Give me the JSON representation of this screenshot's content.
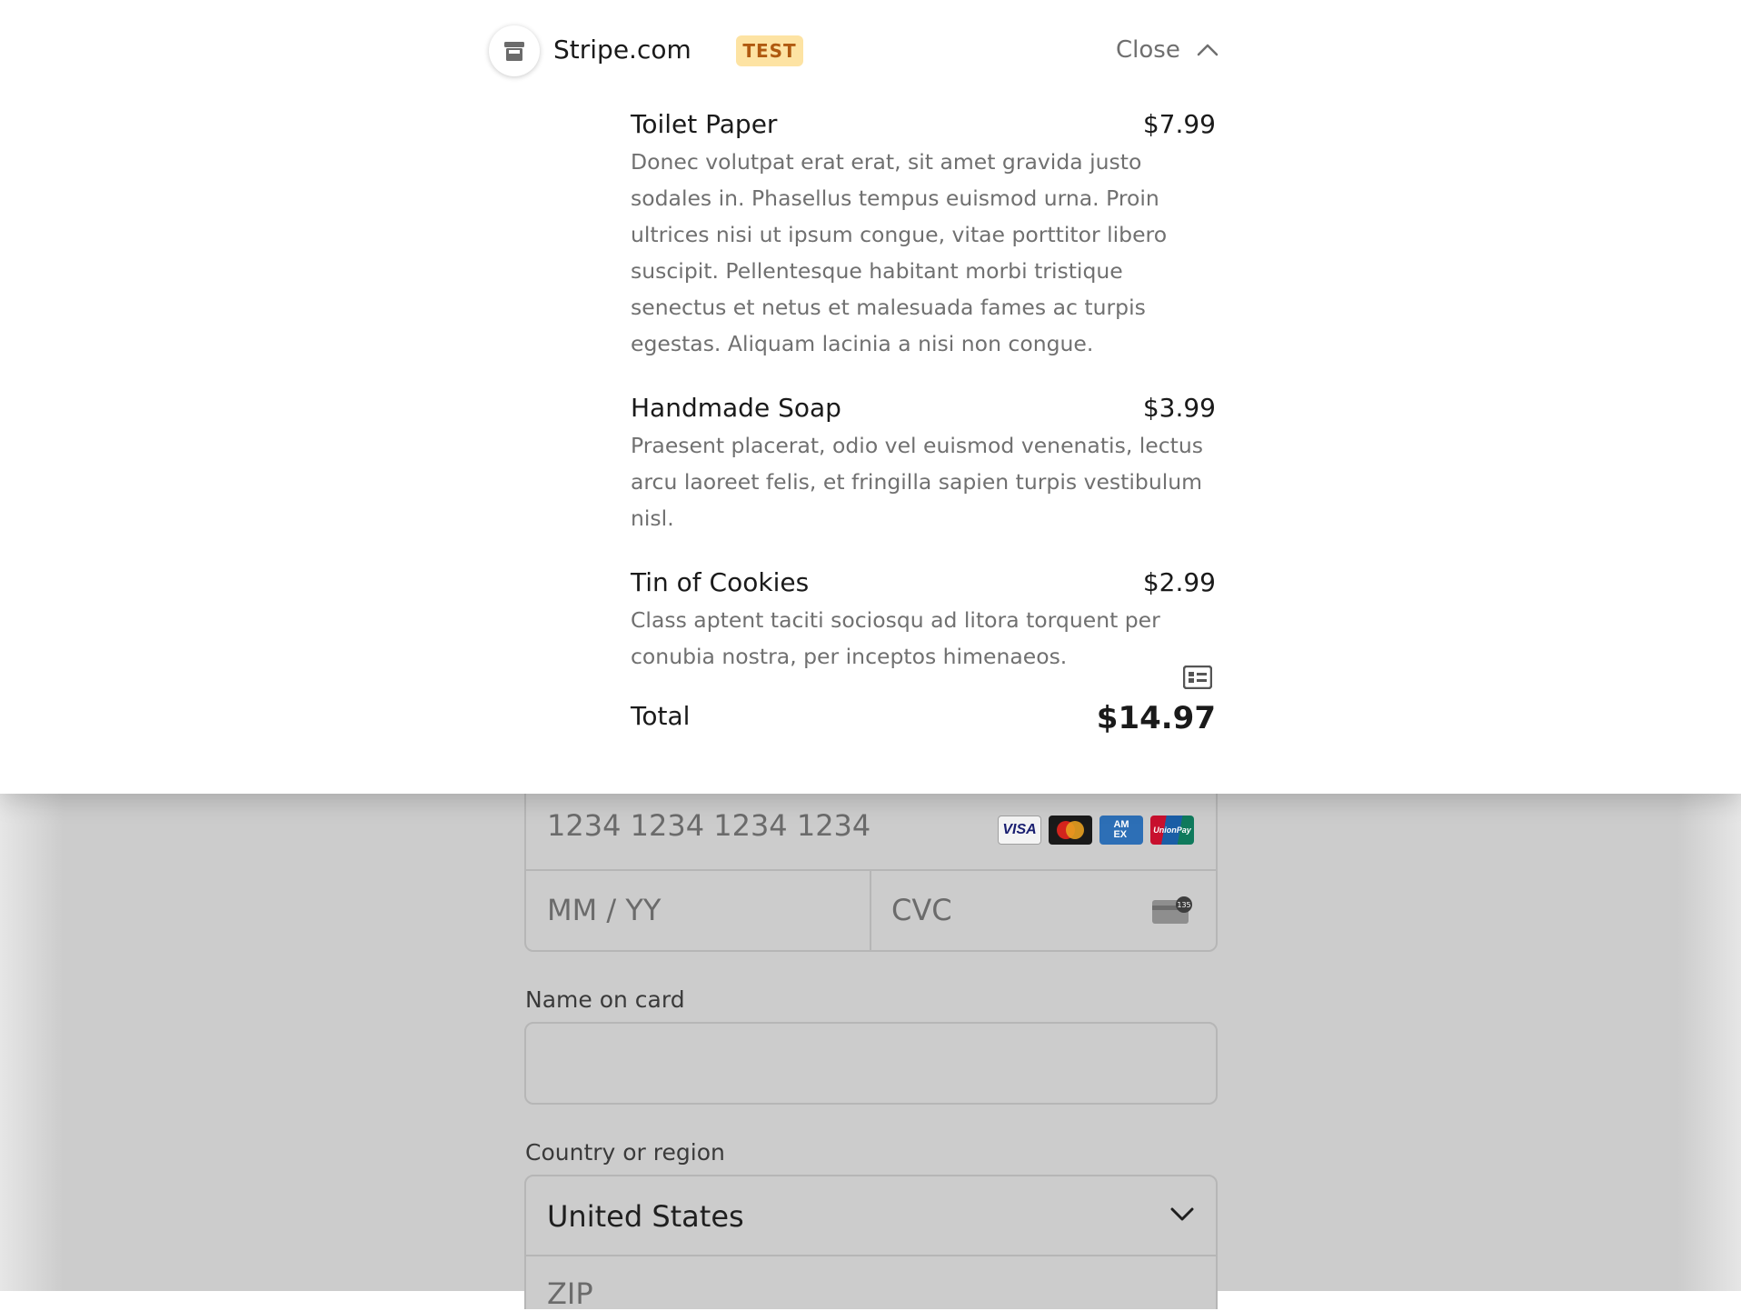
{
  "header": {
    "merchant_name": "Stripe.com",
    "test_badge": "TEST",
    "close_label": "Close"
  },
  "items": [
    {
      "name": "Toilet Paper",
      "price": "$7.99",
      "description": "Donec volutpat erat erat, sit amet gravida justo sodales in. Phasellus tempus euismod urna. Proin ultrices nisi ut ipsum congue, vitae porttitor libero suscipit. Pellentesque habitant morbi tristique senectus et netus et malesuada fames ac turpis egestas. Aliquam lacinia a nisi non congue."
    },
    {
      "name": "Handmade Soap",
      "price": "$3.99",
      "description": "Praesent placerat, odio vel euismod venenatis, lectus arcu laoreet felis, et fringilla sapien turpis vestibulum nisl."
    },
    {
      "name": "Tin of Cookies",
      "price": "$2.99",
      "description": "Class aptent taciti sociosqu ad litora torquent per conubia nostra, per inceptos himenaeos."
    }
  ],
  "total": {
    "label": "Total",
    "amount": "$14.97"
  },
  "payment_form": {
    "card_number_placeholder": "1234 1234 1234 1234",
    "expiry_placeholder": "MM / YY",
    "cvc_placeholder": "CVC",
    "card_brands": [
      "VISA",
      "Mastercard",
      "AMEX",
      "UnionPay"
    ],
    "cvc_hint": "135",
    "name_label": "Name on card",
    "name_value": "",
    "country_label": "Country or region",
    "country_value": "United States",
    "zip_placeholder": "ZIP"
  },
  "colors": {
    "test_badge_bg": "#fde3a3",
    "test_badge_text": "#b05a10",
    "overlay_bg": "#cccccc"
  }
}
